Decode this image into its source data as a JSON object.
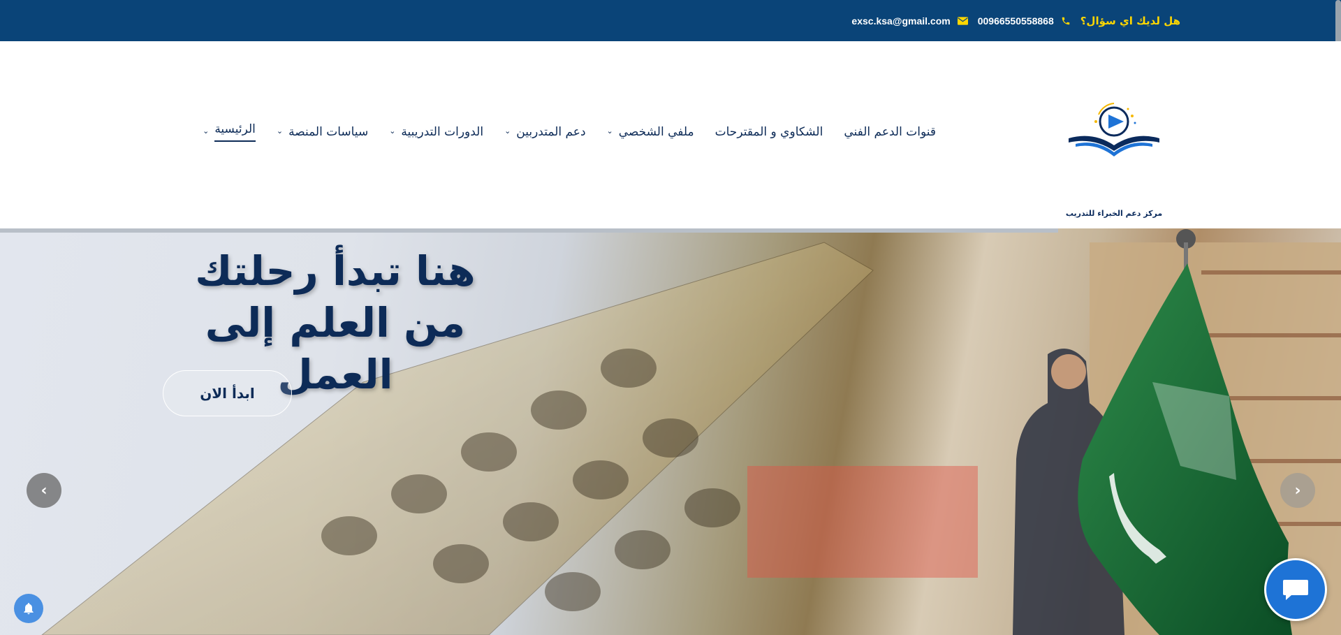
{
  "topbar": {
    "question": "هل لديك اي سؤال؟",
    "phone": "00966550558868",
    "email": "exsc.ksa@gmail.com",
    "phone_icon": "phone-icon",
    "email_icon": "envelope-icon"
  },
  "logo": {
    "text": "مركز دعم الخبراء للتدريب"
  },
  "nav": {
    "items": [
      {
        "label": "الرئيسية",
        "has_dropdown": true,
        "active": true
      },
      {
        "label": "سياسات المنصة",
        "has_dropdown": true
      },
      {
        "label": "الدورات التدريبية",
        "has_dropdown": true
      },
      {
        "label": "دعم المتدربين",
        "has_dropdown": true
      },
      {
        "label": "ملفي الشخصي",
        "has_dropdown": true
      },
      {
        "label": "الشكاوي و المقترحات",
        "has_dropdown": false
      },
      {
        "label": "قنوات الدعم الفني",
        "has_dropdown": false
      }
    ]
  },
  "hero": {
    "title_line1": "هنا تبدأ رحلتك",
    "title_line2": "من العلم إلى العمل",
    "cta_label": "ابدأ الان"
  },
  "colors": {
    "topbar_bg": "#0a4478",
    "accent_yellow": "#ffd700",
    "nav_text": "#0d2b57",
    "chat_blue": "#1e73d6"
  }
}
